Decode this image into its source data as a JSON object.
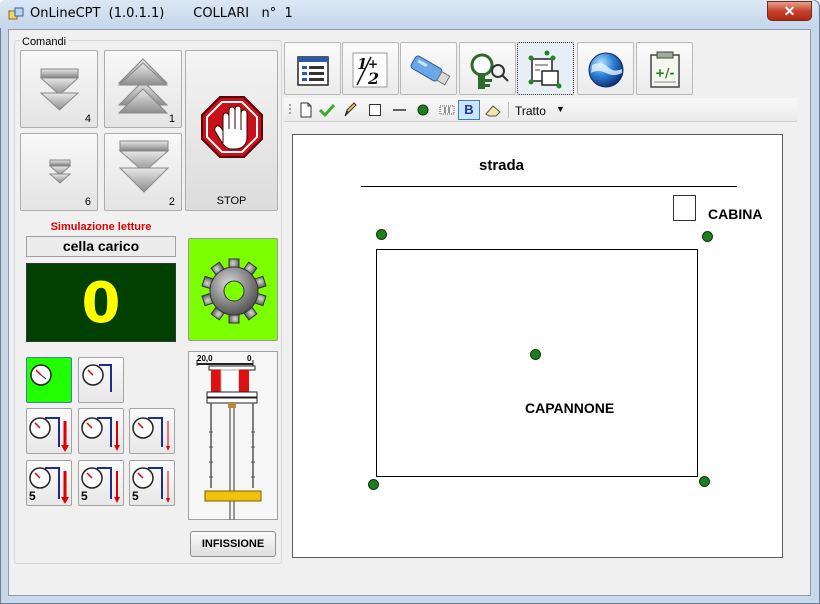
{
  "window": {
    "title": "OnLineCPT  (1.0.1.1)       COLLARI   n°  1",
    "close_glyph": "✕"
  },
  "commands": {
    "group_label": "Comandi",
    "buttons": [
      {
        "name": "down-4",
        "number": "4"
      },
      {
        "name": "up-1",
        "number": "1"
      },
      {
        "name": "down-small-6",
        "number": "6"
      },
      {
        "name": "down-2",
        "number": "2"
      }
    ],
    "stop_label": "STOP"
  },
  "simulation": {
    "title": "Simulazione letture",
    "cell_label": "cella carico",
    "counter_value": "0",
    "counter_color": "#ffff00",
    "counter_bg": "#004000",
    "gear_bg": "#7cff00"
  },
  "gauges": {
    "row3_labels": [
      "5",
      "5",
      "5"
    ]
  },
  "piston": {
    "left_label": "20,0",
    "right_label": "0"
  },
  "infissione_label": "INFISSIONE",
  "toolbar": {
    "icons": [
      "form-icon",
      "numbers-icon",
      "usb-drive-icon",
      "search-key-icon",
      "map-layout-icon",
      "globe-icon",
      "calculator-notes-icon"
    ],
    "selected_index": 4
  },
  "draw_toolbar": {
    "stroke_label": "Tratto",
    "bold_label": "B"
  },
  "canvas": {
    "road_label": "strada",
    "cabin_label": "CABINA",
    "building_label": "CAPANNONE",
    "dot_color": "#1e7d1e"
  }
}
